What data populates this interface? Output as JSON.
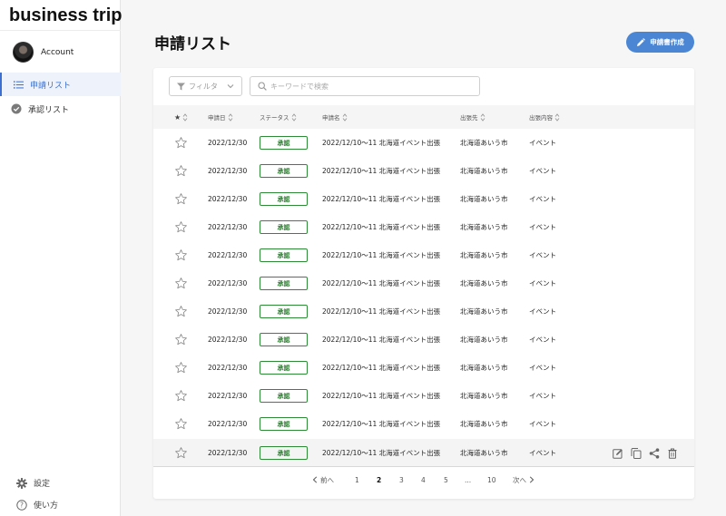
{
  "app": {
    "title": "business trip"
  },
  "account": {
    "name": "Account"
  },
  "sidebar": {
    "items": [
      {
        "label": "申請リスト",
        "icon": "list-icon",
        "active": true
      },
      {
        "label": "承認リスト",
        "icon": "check-circle-icon",
        "active": false
      }
    ],
    "footer": [
      {
        "label": "設定",
        "icon": "gear-icon"
      },
      {
        "label": "使い方",
        "icon": "help-icon"
      }
    ]
  },
  "page": {
    "title": "申請リスト"
  },
  "toolbar": {
    "create_label": "申請書作成",
    "filter_label": "フィルタ",
    "search_placeholder": "キーワードで検索"
  },
  "table": {
    "columns": {
      "star": "★",
      "date": "申請日",
      "status": "ステータス",
      "name": "申請名",
      "destination": "出張先",
      "content": "出張内容"
    },
    "rows": [
      {
        "date": "2022/12/30",
        "status": "承認",
        "name": "2022/12/10〜11 北海道イベント出張",
        "destination": "北海道あいう市",
        "content": "イベント"
      },
      {
        "date": "2022/12/30",
        "status": "承認",
        "name": "2022/12/10〜11 北海道イベント出張",
        "destination": "北海道あいう市",
        "content": "イベント"
      },
      {
        "date": "2022/12/30",
        "status": "承認",
        "name": "2022/12/10〜11 北海道イベント出張",
        "destination": "北海道あいう市",
        "content": "イベント"
      },
      {
        "date": "2022/12/30",
        "status": "承認",
        "name": "2022/12/10〜11 北海道イベント出張",
        "destination": "北海道あいう市",
        "content": "イベント"
      },
      {
        "date": "2022/12/30",
        "status": "承認",
        "name": "2022/12/10〜11 北海道イベント出張",
        "destination": "北海道あいう市",
        "content": "イベント"
      },
      {
        "date": "2022/12/30",
        "status": "承認",
        "name": "2022/12/10〜11 北海道イベント出張",
        "destination": "北海道あいう市",
        "content": "イベント"
      },
      {
        "date": "2022/12/30",
        "status": "承認",
        "name": "2022/12/10〜11 北海道イベント出張",
        "destination": "北海道あいう市",
        "content": "イベント"
      },
      {
        "date": "2022/12/30",
        "status": "承認",
        "name": "2022/12/10〜11 北海道イベント出張",
        "destination": "北海道あいう市",
        "content": "イベント"
      },
      {
        "date": "2022/12/30",
        "status": "承認",
        "name": "2022/12/10〜11 北海道イベント出張",
        "destination": "北海道あいう市",
        "content": "イベント"
      },
      {
        "date": "2022/12/30",
        "status": "承認",
        "name": "2022/12/10〜11 北海道イベント出張",
        "destination": "北海道あいう市",
        "content": "イベント"
      },
      {
        "date": "2022/12/30",
        "status": "承認",
        "name": "2022/12/10〜11 北海道イベント出張",
        "destination": "北海道あいう市",
        "content": "イベント"
      },
      {
        "date": "2022/12/30",
        "status": "承認",
        "name": "2022/12/10〜11 北海道イベント出張",
        "destination": "北海道あいう市",
        "content": "イベント"
      }
    ],
    "hover_row_actions": [
      "edit-icon",
      "copy-icon",
      "share-icon",
      "trash-icon"
    ]
  },
  "pagination": {
    "prev": "前へ",
    "next": "次へ",
    "pages": [
      "1",
      "2",
      "3",
      "4",
      "5",
      "...",
      "10"
    ],
    "current": "2"
  },
  "colors": {
    "accent": "#4a86d4",
    "active_nav": "#3b6fd1",
    "approved": "#2e8b35"
  }
}
